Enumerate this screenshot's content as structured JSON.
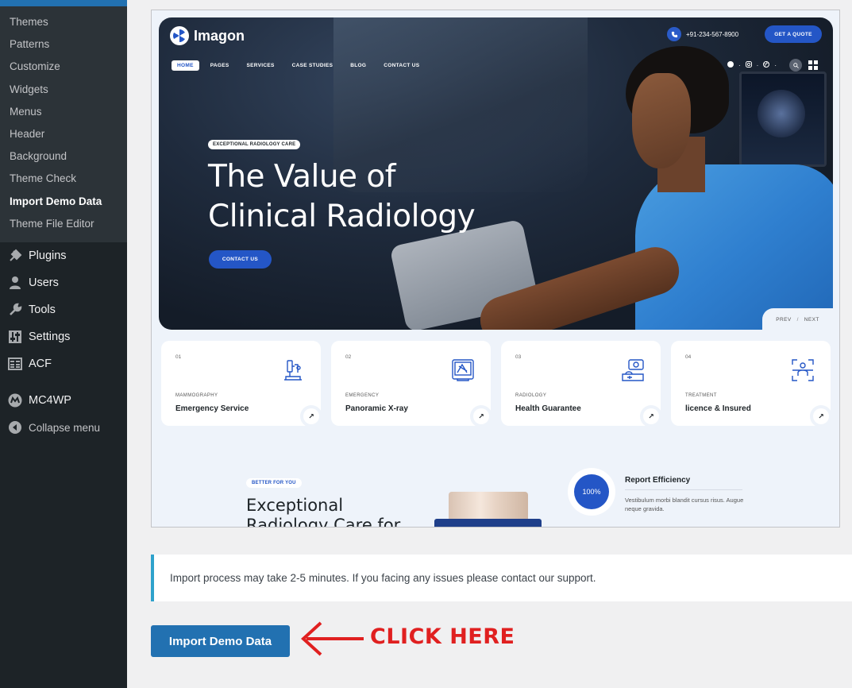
{
  "sidebar": {
    "submenu": [
      {
        "label": "Themes",
        "current": false
      },
      {
        "label": "Patterns",
        "current": false
      },
      {
        "label": "Customize",
        "current": false
      },
      {
        "label": "Widgets",
        "current": false
      },
      {
        "label": "Menus",
        "current": false
      },
      {
        "label": "Header",
        "current": false
      },
      {
        "label": "Background",
        "current": false
      },
      {
        "label": "Theme Check",
        "current": false
      },
      {
        "label": "Import Demo Data",
        "current": true
      },
      {
        "label": "Theme File Editor",
        "current": false
      }
    ],
    "menu": [
      {
        "label": "Plugins",
        "icon": "plugin-icon"
      },
      {
        "label": "Users",
        "icon": "user-icon"
      },
      {
        "label": "Tools",
        "icon": "wrench-icon"
      },
      {
        "label": "Settings",
        "icon": "settings-sliders-icon"
      },
      {
        "label": "ACF",
        "icon": "grid-table-icon"
      },
      {
        "label": "MC4WP",
        "icon": "mc4wp-icon"
      },
      {
        "label": "Collapse menu",
        "icon": "collapse-arrow-icon"
      }
    ]
  },
  "preview": {
    "logo": "Imagon",
    "phone": "+91-234-567-8900",
    "quote_button": "GET A QUOTE",
    "nav": [
      "HOME",
      "PAGES",
      "SERVICES",
      "CASE STUDIES",
      "BLOG",
      "CONTACT US"
    ],
    "hero_badge": "EXCEPTIONAL RADIOLOGY CARE",
    "hero_title_line1": "The Value of",
    "hero_title_line2": "Clinical Radiology",
    "hero_button": "CONTACT US",
    "prev": "PREV",
    "slash": "/",
    "next": "NEXT",
    "cards": [
      {
        "num": "01",
        "category": "MAMMOGRAPHY",
        "title": "Emergency Service",
        "icon": "microscope-icon"
      },
      {
        "num": "02",
        "category": "EMERGENCY",
        "title": "Panoramic X-ray",
        "icon": "xray-film-icon"
      },
      {
        "num": "03",
        "category": "RADIOLOGY",
        "title": "Health Guarantee",
        "icon": "mri-scanner-icon"
      },
      {
        "num": "04",
        "category": "TREATMENT",
        "title": "licence & Insured",
        "icon": "body-scan-icon"
      }
    ],
    "lower_tag": "BETTER FOR YOU",
    "lower_title": "Exceptional Radiology Care for",
    "efficiency_value": "100%",
    "efficiency_title": "Report Efficiency",
    "efficiency_text": "Vestibulum morbi blandit cursus risus. Augue neque gravida."
  },
  "notice": {
    "text": "Import process may take 2-5 minutes. If you facing any issues please contact our support."
  },
  "import_button": "Import Demo Data",
  "annotation": {
    "text": "CLICK HERE",
    "color": "#e02020"
  },
  "colors": {
    "wp_blue": "#2271b1",
    "sidebar_bg": "#1d2327",
    "theme_blue": "#2456c6",
    "notice_border": "#2ea2cc"
  }
}
